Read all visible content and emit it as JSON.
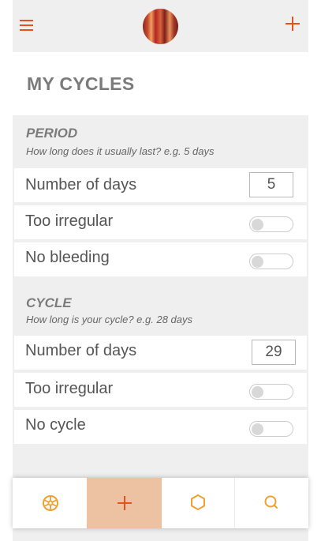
{
  "header": {
    "menu_icon": "hamburger-menu-icon",
    "avatar": "user-avatar",
    "add_icon": "plus-icon"
  },
  "page": {
    "title": "MY CYCLES"
  },
  "period": {
    "title": "PERIOD",
    "hint": "How long does it usually last? e.g. 5 days",
    "days_label": "Number of days",
    "days_value": "5",
    "irregular_label": "Too irregular",
    "irregular_on": false,
    "no_bleeding_label": "No bleeding",
    "no_bleeding_on": false
  },
  "cycle": {
    "title": "CYCLE",
    "hint": "How long is your cycle? e.g. 28 days",
    "days_label": "Number of days",
    "days_value": "29",
    "irregular_label": "Too irregular",
    "irregular_on": false,
    "no_cycle_label": "No cycle",
    "no_cycle_on": false
  },
  "bottom_nav": {
    "items": [
      {
        "icon": "wheel-icon",
        "active": false
      },
      {
        "icon": "plus-icon",
        "active": true
      },
      {
        "icon": "hexagon-icon",
        "active": false
      },
      {
        "icon": "search-icon",
        "active": false
      }
    ]
  },
  "colors": {
    "accent": "#e8501c",
    "nav_icon": "#f0a030",
    "active_tab_bg": "#ecc2a2",
    "section_bg": "#efefef"
  }
}
